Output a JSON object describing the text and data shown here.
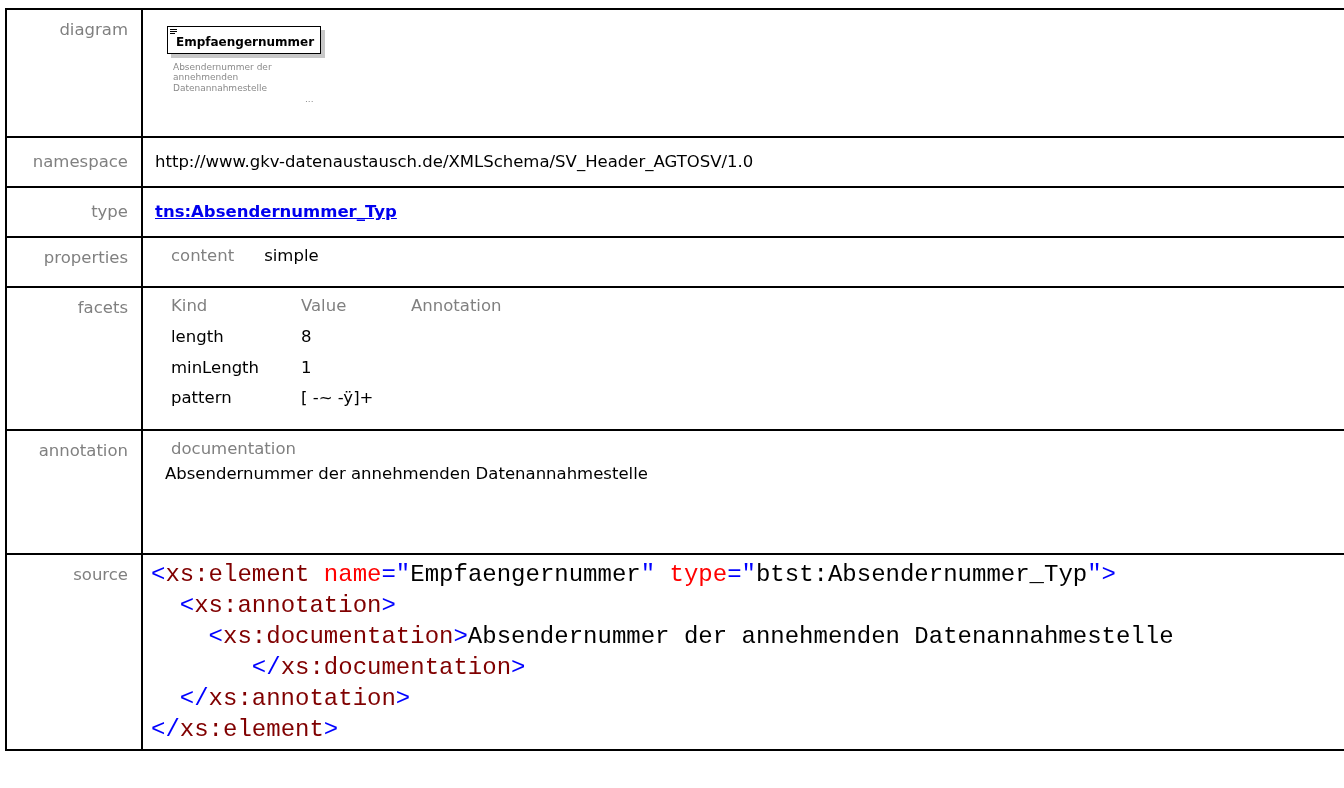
{
  "diagram": {
    "label": "diagram",
    "element_name": "Empfaengernummer",
    "documentation": "Absendernummer der annehmenden Datenannahmestelle",
    "ellipsis": "..."
  },
  "namespace": {
    "label": "namespace",
    "value": "http://www.gkv-datenaustausch.de/XMLSchema/SV_Header_AGTOSV/1.0"
  },
  "type": {
    "label": "type",
    "value": "tns:Absendernummer_Typ"
  },
  "properties": {
    "label": "properties",
    "items": [
      {
        "name": "content",
        "value": "simple"
      }
    ]
  },
  "facets": {
    "label": "facets",
    "columns": [
      "Kind",
      "Value",
      "Annotation"
    ],
    "rows": [
      {
        "kind": "length",
        "value": "8"
      },
      {
        "kind": "minLength",
        "value": "1"
      },
      {
        "kind": "pattern",
        "value": "[ -~ -ÿ]+"
      }
    ]
  },
  "annotation": {
    "label": "annotation",
    "heading": "documentation",
    "text": "Absendernummer der annehmenden Datenannahmestelle"
  },
  "source": {
    "label": "source",
    "lines": [
      [
        {
          "kind": "punct",
          "text": "<"
        },
        {
          "kind": "tag",
          "text": "xs:element "
        },
        {
          "kind": "attr",
          "text": "name"
        },
        {
          "kind": "punct",
          "text": "=\""
        },
        {
          "kind": "text",
          "text": "Empfaengernummer"
        },
        {
          "kind": "punct",
          "text": "\" "
        },
        {
          "kind": "attr",
          "text": "type"
        },
        {
          "kind": "punct",
          "text": "=\""
        },
        {
          "kind": "text",
          "text": "btst:Absendernummer_Typ"
        },
        {
          "kind": "punct",
          "text": "\">"
        }
      ],
      [
        {
          "kind": "punct",
          "text": "  <"
        },
        {
          "kind": "tag",
          "text": "xs:annotation"
        },
        {
          "kind": "punct",
          "text": ">"
        }
      ],
      [
        {
          "kind": "punct",
          "text": "    <"
        },
        {
          "kind": "tag",
          "text": "xs:documentation"
        },
        {
          "kind": "punct",
          "text": ">"
        },
        {
          "kind": "text",
          "text": "Absendernummer der annehmenden Datenannahmestelle\n"
        }
      ],
      [
        {
          "kind": "punct",
          "text": "       </"
        },
        {
          "kind": "tag",
          "text": "xs:documentation"
        },
        {
          "kind": "punct",
          "text": ">"
        }
      ],
      [
        {
          "kind": "punct",
          "text": "  </"
        },
        {
          "kind": "tag",
          "text": "xs:annotation"
        },
        {
          "kind": "punct",
          "text": ">"
        }
      ],
      [
        {
          "kind": "punct",
          "text": "</"
        },
        {
          "kind": "tag",
          "text": "xs:element"
        },
        {
          "kind": "punct",
          "text": ">"
        }
      ]
    ]
  }
}
